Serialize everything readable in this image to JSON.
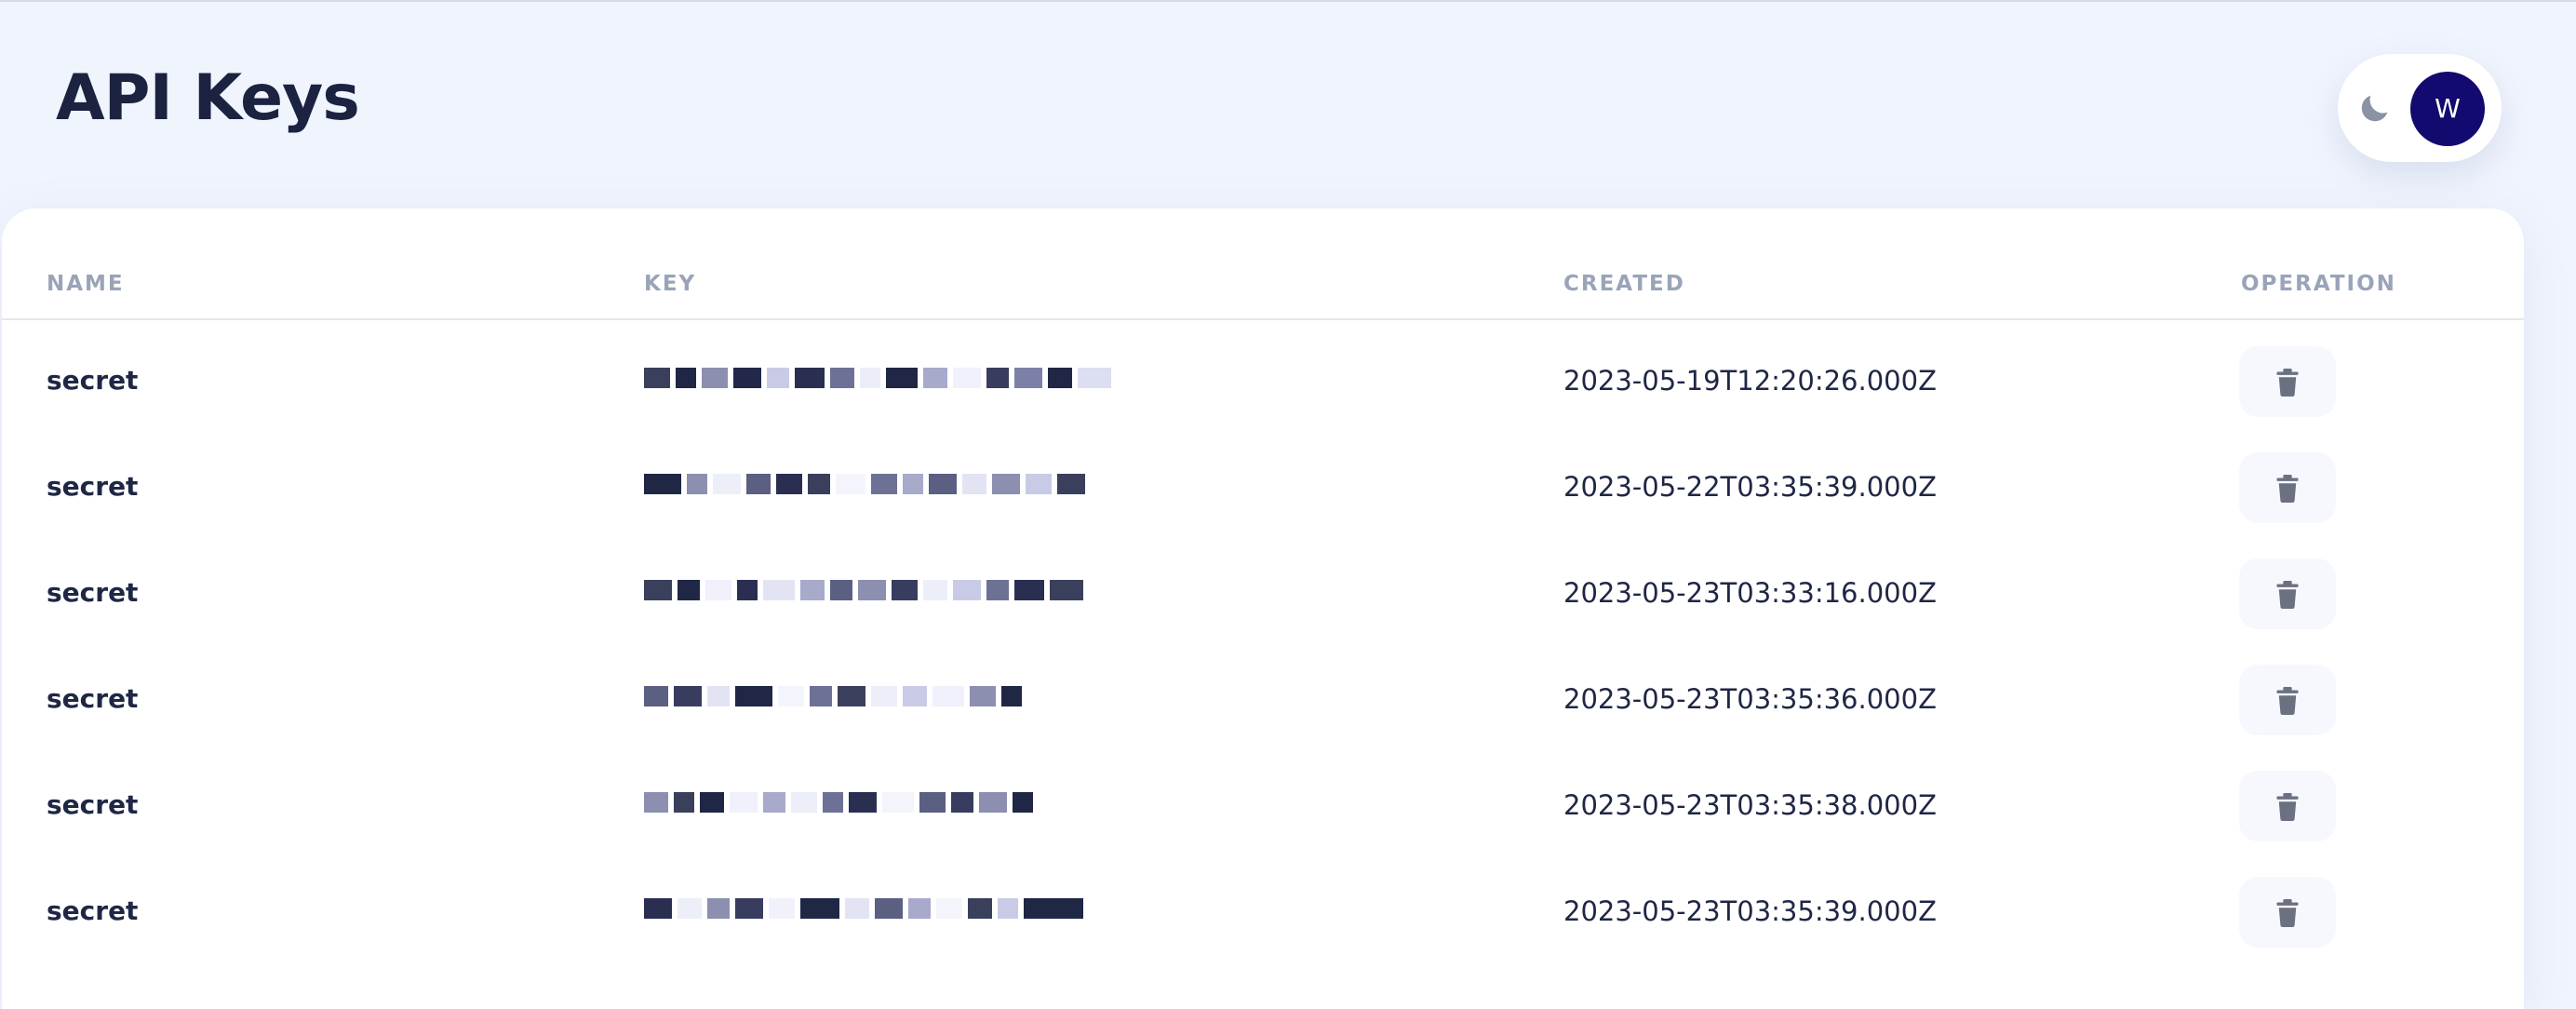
{
  "page": {
    "title": "API Keys"
  },
  "user": {
    "avatar_initial": "W",
    "theme_icon": "moon-icon"
  },
  "table": {
    "columns": [
      "NAME",
      "KEY",
      "CREATED",
      "OPERATION"
    ],
    "rows": [
      {
        "name": "secret",
        "key": "",
        "created": "2023-05-19T12:20:26.000Z",
        "operation_icon": "trash-icon"
      },
      {
        "name": "secret",
        "key": "",
        "created": "2023-05-22T03:35:39.000Z",
        "operation_icon": "trash-icon"
      },
      {
        "name": "secret",
        "key": "",
        "created": "2023-05-23T03:33:16.000Z",
        "operation_icon": "trash-icon"
      },
      {
        "name": "secret",
        "key": "",
        "created": "2023-05-23T03:35:36.000Z",
        "operation_icon": "trash-icon"
      },
      {
        "name": "secret",
        "key": "",
        "created": "2023-05-23T03:35:38.000Z",
        "operation_icon": "trash-icon"
      },
      {
        "name": "secret",
        "key": "",
        "created": "2023-05-23T03:35:39.000Z",
        "operation_icon": "trash-icon"
      }
    ]
  },
  "colors": {
    "background": "#f0f4fd",
    "card": "#ffffff",
    "avatar": "#120a6e",
    "header_text": "#9aa4b8",
    "body_text": "#1f2745",
    "icon": "#6b7180"
  }
}
